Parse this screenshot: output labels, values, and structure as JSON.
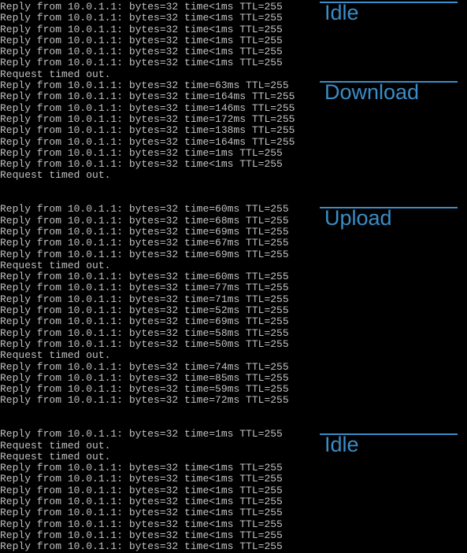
{
  "sections": [
    {
      "label": "Idle"
    },
    {
      "label": "Download"
    },
    {
      "label": "Upload"
    },
    {
      "label": "Idle"
    }
  ],
  "lines": [
    "Reply from 10.0.1.1: bytes=32 time<1ms TTL=255",
    "Reply from 10.0.1.1: bytes=32 time<1ms TTL=255",
    "Reply from 10.0.1.1: bytes=32 time<1ms TTL=255",
    "Reply from 10.0.1.1: bytes=32 time<1ms TTL=255",
    "Reply from 10.0.1.1: bytes=32 time<1ms TTL=255",
    "Reply from 10.0.1.1: bytes=32 time<1ms TTL=255",
    "Request timed out.",
    "Reply from 10.0.1.1: bytes=32 time=63ms TTL=255",
    "Reply from 10.0.1.1: bytes=32 time=164ms TTL=255",
    "Reply from 10.0.1.1: bytes=32 time=146ms TTL=255",
    "Reply from 10.0.1.1: bytes=32 time=172ms TTL=255",
    "Reply from 10.0.1.1: bytes=32 time=138ms TTL=255",
    "Reply from 10.0.1.1: bytes=32 time=164ms TTL=255",
    "Reply from 10.0.1.1: bytes=32 time=1ms TTL=255",
    "Reply from 10.0.1.1: bytes=32 time<1ms TTL=255",
    "Request timed out.",
    "",
    "",
    "Reply from 10.0.1.1: bytes=32 time=60ms TTL=255",
    "Reply from 10.0.1.1: bytes=32 time=68ms TTL=255",
    "Reply from 10.0.1.1: bytes=32 time=69ms TTL=255",
    "Reply from 10.0.1.1: bytes=32 time=67ms TTL=255",
    "Reply from 10.0.1.1: bytes=32 time=69ms TTL=255",
    "Request timed out.",
    "Reply from 10.0.1.1: bytes=32 time=60ms TTL=255",
    "Reply from 10.0.1.1: bytes=32 time=77ms TTL=255",
    "Reply from 10.0.1.1: bytes=32 time=71ms TTL=255",
    "Reply from 10.0.1.1: bytes=32 time=52ms TTL=255",
    "Reply from 10.0.1.1: bytes=32 time=69ms TTL=255",
    "Reply from 10.0.1.1: bytes=32 time=58ms TTL=255",
    "Reply from 10.0.1.1: bytes=32 time=50ms TTL=255",
    "Request timed out.",
    "Reply from 10.0.1.1: bytes=32 time=74ms TTL=255",
    "Reply from 10.0.1.1: bytes=32 time=85ms TTL=255",
    "Reply from 10.0.1.1: bytes=32 time=59ms TTL=255",
    "Reply from 10.0.1.1: bytes=32 time=72ms TTL=255",
    "",
    "",
    "Reply from 10.0.1.1: bytes=32 time=1ms TTL=255",
    "Request timed out.",
    "Request timed out.",
    "Reply from 10.0.1.1: bytes=32 time<1ms TTL=255",
    "Reply from 10.0.1.1: bytes=32 time<1ms TTL=255",
    "Reply from 10.0.1.1: bytes=32 time<1ms TTL=255",
    "Reply from 10.0.1.1: bytes=32 time<1ms TTL=255",
    "Reply from 10.0.1.1: bytes=32 time<1ms TTL=255",
    "Reply from 10.0.1.1: bytes=32 time<1ms TTL=255",
    "Reply from 10.0.1.1: bytes=32 time<1ms TTL=255",
    "Reply from 10.0.1.1: bytes=32 time<1ms TTL=255"
  ]
}
